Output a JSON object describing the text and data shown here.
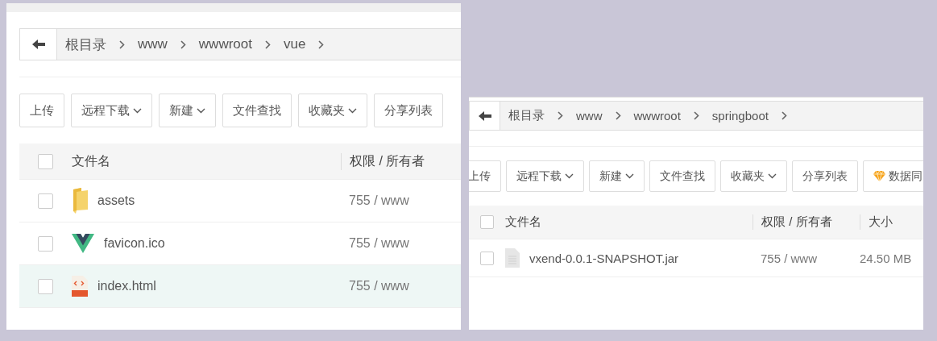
{
  "panels": [
    {
      "breadcrumb": [
        "根目录",
        "www",
        "wwwroot",
        "vue"
      ],
      "toolbar": [
        {
          "label": "上传",
          "dropdown": false,
          "kind": "plain"
        },
        {
          "label": "远程下载",
          "dropdown": true,
          "kind": "plain"
        },
        {
          "label": "新建",
          "dropdown": true,
          "kind": "plain"
        },
        {
          "label": "文件查找",
          "dropdown": false,
          "kind": "plain"
        },
        {
          "label": "收藏夹",
          "dropdown": true,
          "kind": "plain"
        },
        {
          "label": "分享列表",
          "dropdown": false,
          "kind": "plain"
        }
      ],
      "select_all_checked": false,
      "columns": [
        "文件名",
        "权限 / 所有者"
      ],
      "rows": [
        {
          "kind": "folder",
          "cells": [
            "assets",
            "755 / www"
          ],
          "checked": false,
          "highlighted": false
        },
        {
          "kind": "vue",
          "cells": [
            "favicon.ico",
            "755 / www"
          ],
          "checked": false,
          "highlighted": false
        },
        {
          "kind": "html",
          "cells": [
            "index.html",
            "755 / www"
          ],
          "checked": false,
          "highlighted": true
        }
      ]
    },
    {
      "breadcrumb": [
        "根目录",
        "www",
        "wwwroot",
        "springboot"
      ],
      "toolbar": [
        {
          "label": "上传",
          "dropdown": false,
          "kind": "plain"
        },
        {
          "label": "远程下载",
          "dropdown": true,
          "kind": "plain"
        },
        {
          "label": "新建",
          "dropdown": true,
          "kind": "plain"
        },
        {
          "label": "文件查找",
          "dropdown": false,
          "kind": "plain"
        },
        {
          "label": "收藏夹",
          "dropdown": true,
          "kind": "plain"
        },
        {
          "label": "分享列表",
          "dropdown": false,
          "kind": "plain"
        },
        {
          "label": "数据同",
          "dropdown": false,
          "kind": "premium"
        }
      ],
      "select_all_checked": false,
      "columns": [
        "文件名",
        "权限 / 所有者",
        "大小"
      ],
      "rows": [
        {
          "kind": "file",
          "cells": [
            "vxend-0.0.1-SNAPSHOT.jar",
            "755 / www",
            "24.50 MB"
          ],
          "checked": false,
          "highlighted": false
        }
      ]
    }
  ]
}
